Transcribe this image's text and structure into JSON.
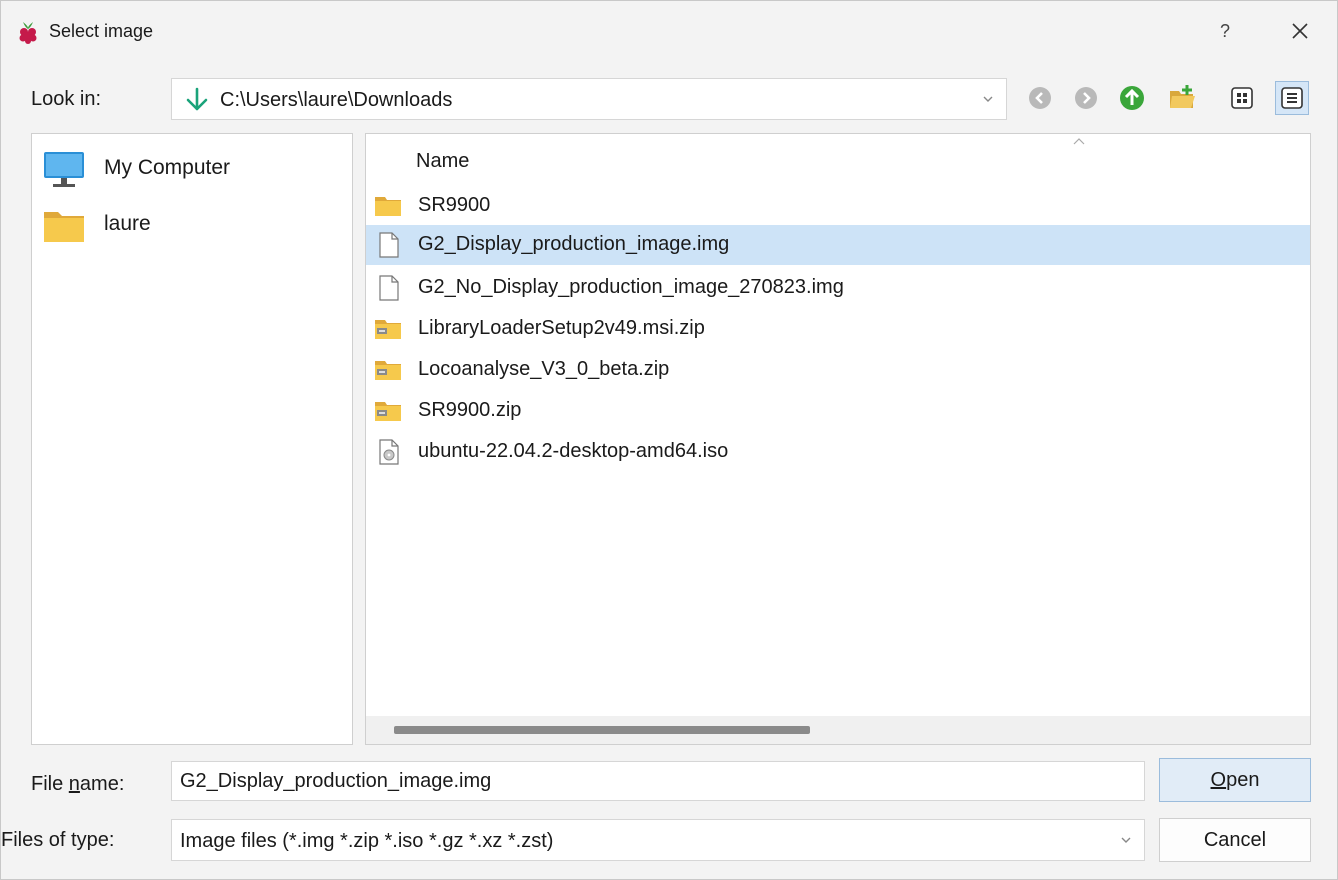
{
  "window": {
    "title": "Select image",
    "help_label": "?",
    "close_label": "✕"
  },
  "lookin": {
    "label": "Look in:",
    "path": "C:\\Users\\laure\\Downloads"
  },
  "sidebar": {
    "items": [
      {
        "label": "My Computer",
        "icon": "monitor-icon"
      },
      {
        "label": "laure",
        "icon": "folder-icon"
      }
    ]
  },
  "filelist": {
    "column_header": "Name",
    "rows": [
      {
        "name": "SR9900",
        "icon": "folder-icon",
        "selected": false
      },
      {
        "name": "G2_Display_production_image.img",
        "icon": "file-icon",
        "selected": true
      },
      {
        "name": "G2_No_Display_production_image_270823.img",
        "icon": "file-icon",
        "selected": false
      },
      {
        "name": "LibraryLoaderSetup2v49.msi.zip",
        "icon": "zip-folder-icon",
        "selected": false
      },
      {
        "name": "Locoanalyse_V3_0_beta.zip",
        "icon": "zip-folder-icon",
        "selected": false
      },
      {
        "name": "SR9900.zip",
        "icon": "zip-folder-icon",
        "selected": false
      },
      {
        "name": "ubuntu-22.04.2-desktop-amd64.iso",
        "icon": "disc-image-icon",
        "selected": false
      }
    ]
  },
  "filename": {
    "label_pre": "File ",
    "label_accel": "n",
    "label_post": "ame:",
    "value": "G2_Display_production_image.img"
  },
  "filetype": {
    "label": "Files of type:",
    "value": "Image files (*.img *.zip *.iso *.gz *.xz *.zst)"
  },
  "buttons": {
    "open_accel": "O",
    "open_rest": "pen",
    "cancel": "Cancel"
  },
  "colors": {
    "selection": "#cde3f7",
    "accent": "#9bbcdc",
    "folder": "#f6c94c"
  }
}
